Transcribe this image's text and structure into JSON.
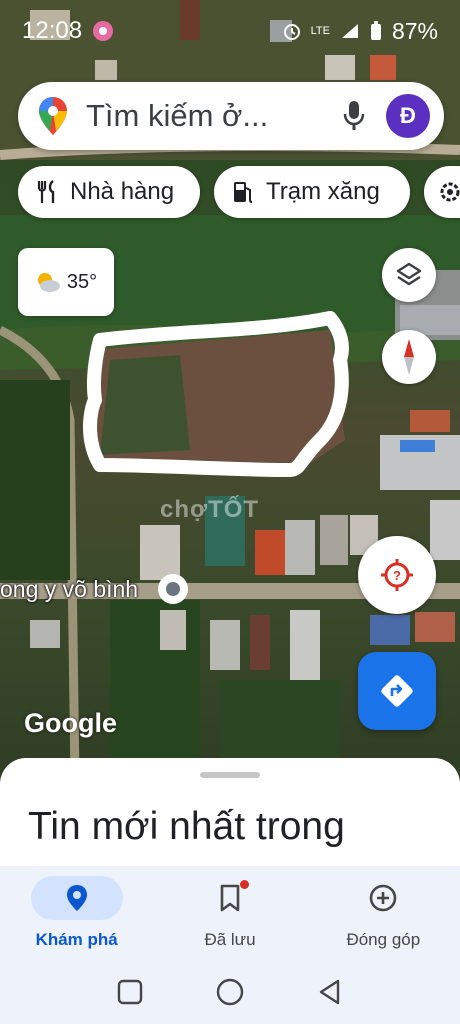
{
  "status_bar": {
    "time": "12:08",
    "network": "LTE",
    "battery": "87%"
  },
  "search": {
    "placeholder": "Tìm kiếm ở...",
    "avatar_initial": "Đ"
  },
  "chips": [
    {
      "label": "Nhà hàng",
      "icon": "restaurant-icon"
    },
    {
      "label": "Trạm xăng",
      "icon": "gas-station-icon"
    },
    {
      "label": "",
      "icon": "more-icon"
    }
  ],
  "weather": {
    "temperature": "35°",
    "icon": "partly-cloudy-icon"
  },
  "map": {
    "place_label": "ong y võ bình",
    "watermark": "chợTỐT",
    "logo": "Google"
  },
  "sheet": {
    "title": "Tin mới nhất trong"
  },
  "bottom_nav": {
    "items": [
      {
        "label": "Khám phá",
        "icon": "explore-pin-icon",
        "active": true
      },
      {
        "label": "Đã lưu",
        "icon": "bookmark-icon",
        "active": false
      },
      {
        "label": "Đóng góp",
        "icon": "add-circle-icon",
        "active": false
      }
    ]
  },
  "colors": {
    "accent": "#1a73e8",
    "avatar": "#5b2fbf",
    "nav_active": "#0b57d0"
  }
}
